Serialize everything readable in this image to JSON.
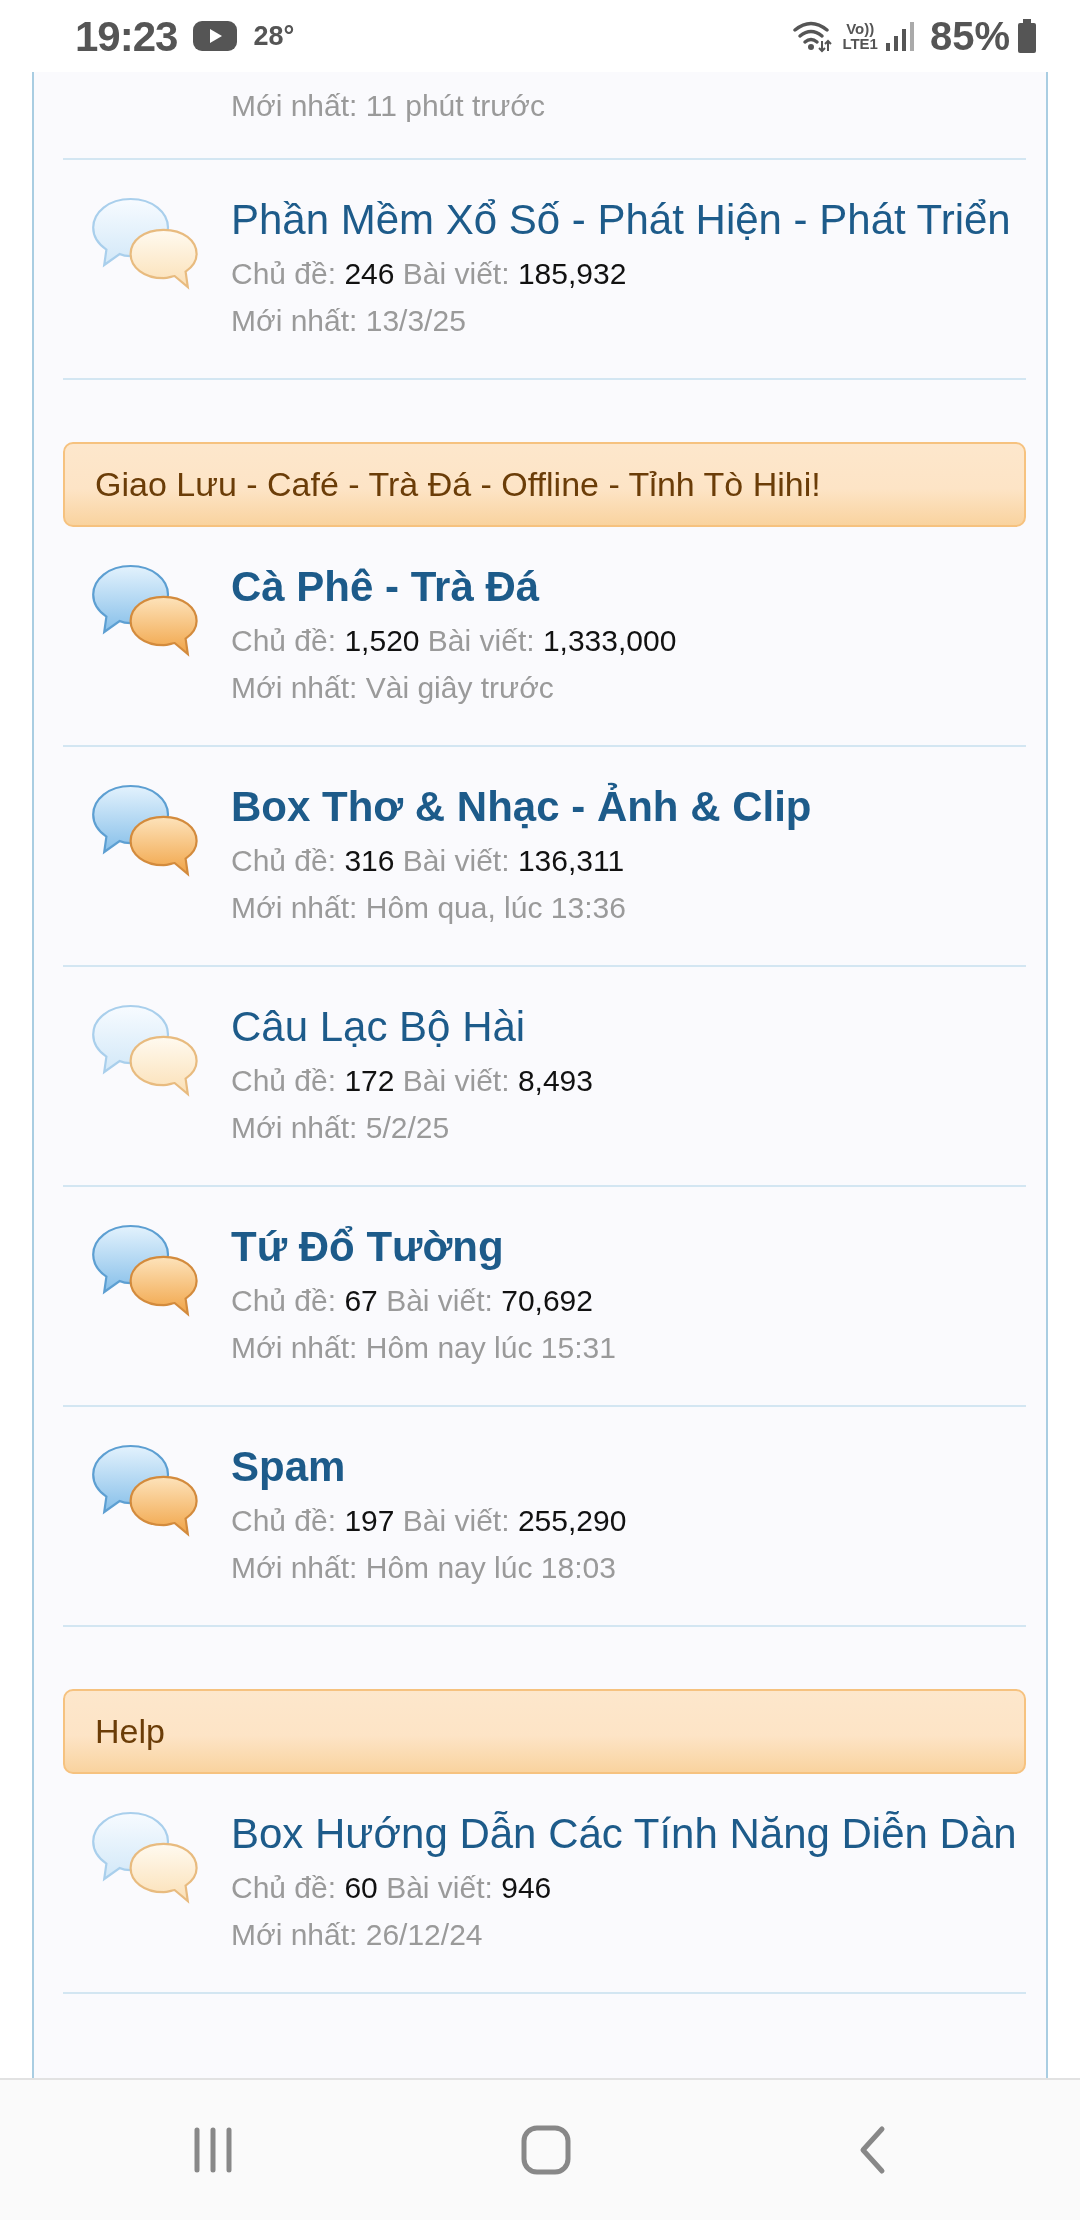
{
  "status_bar": {
    "time": "19:23",
    "temperature": "28°",
    "network_top": "Vo))",
    "network_bottom": "LTE1",
    "battery": "85%"
  },
  "sections": [
    {
      "forums": [
        {
          "latest": "Mới nhất: 11 phút trước"
        },
        {
          "title": "Phần Mềm Xổ Số - Phát Hiện - Phát Triển",
          "unread": false,
          "threads_label": "Chủ đề:",
          "threads": "246",
          "posts_label": "Bài viết:",
          "posts": "185,932",
          "latest": "Mới nhất: 13/3/25"
        }
      ]
    },
    {
      "title": "Giao Lưu - Café - Trà Đá - Offline - Tỉnh Tò Hihi!",
      "forums": [
        {
          "title": "Cà Phê - Trà Đá",
          "unread": true,
          "threads_label": "Chủ đề:",
          "threads": "1,520",
          "posts_label": "Bài viết:",
          "posts": "1,333,000",
          "latest": "Mới nhất: Vài giây trước"
        },
        {
          "title": "Box Thơ & Nhạc - Ảnh & Clip",
          "unread": true,
          "threads_label": "Chủ đề:",
          "threads": "316",
          "posts_label": "Bài viết:",
          "posts": "136,311",
          "latest": "Mới nhất: Hôm qua, lúc 13:36"
        },
        {
          "title": "Câu Lạc Bộ Hài",
          "unread": false,
          "threads_label": "Chủ đề:",
          "threads": "172",
          "posts_label": "Bài viết:",
          "posts": "8,493",
          "latest": "Mới nhất: 5/2/25"
        },
        {
          "title": "Tứ Đổ Tường",
          "unread": true,
          "threads_label": "Chủ đề:",
          "threads": "67",
          "posts_label": "Bài viết:",
          "posts": "70,692",
          "latest": "Mới nhất: Hôm nay lúc 15:31"
        },
        {
          "title": "Spam",
          "unread": true,
          "threads_label": "Chủ đề:",
          "threads": "197",
          "posts_label": "Bài viết:",
          "posts": "255,290",
          "latest": "Mới nhất: Hôm nay lúc 18:03"
        }
      ]
    },
    {
      "title": "Help",
      "forums": [
        {
          "title": "Box Hướng Dẫn Các Tính Năng Diễn Dàn",
          "unread": false,
          "threads_label": "Chủ đề:",
          "threads": "60",
          "posts_label": "Bài viết:",
          "posts": "946",
          "latest": "Mới nhất: 26/12/24"
        }
      ]
    }
  ]
}
